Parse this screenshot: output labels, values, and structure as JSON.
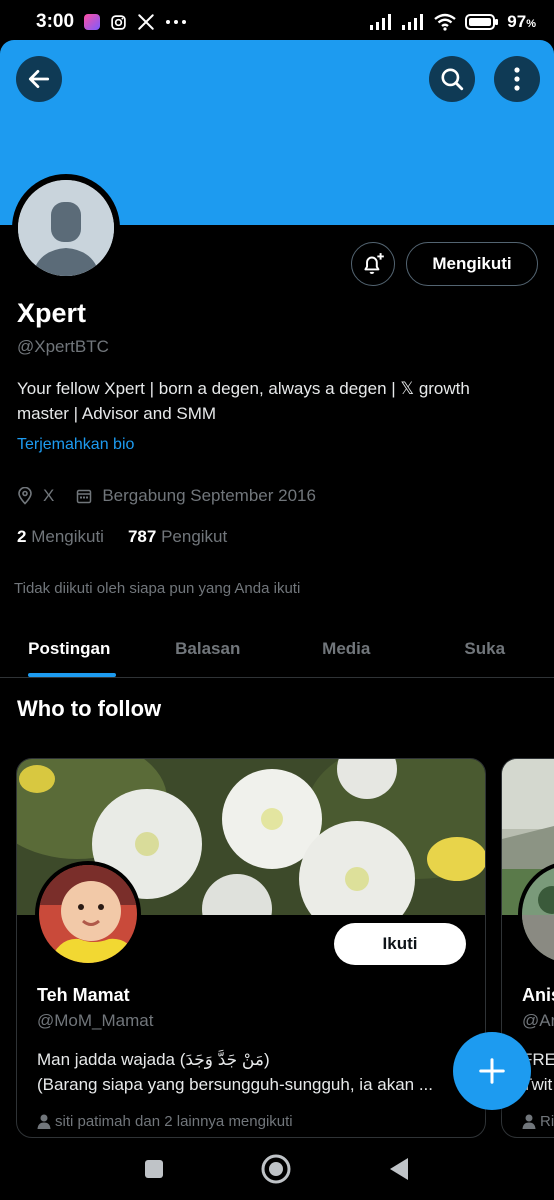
{
  "status_bar": {
    "time": "3:00",
    "battery": "97",
    "battery_unit": "%"
  },
  "header": {
    "back_icon": "arrow-left-icon",
    "search_icon": "search-icon",
    "more_icon": "more-vertical-icon",
    "banner_color": "#1d9bf0"
  },
  "profile": {
    "name": "Xpert",
    "handle": "@XpertBTC",
    "bio_line1": "Your fellow Xpert | born a degen, always a degen | 𝕏 growth",
    "bio_line2": "master | Advisor and SMM",
    "translate_label": "Terjemahkan bio",
    "location": "X",
    "joined": "Bergabung September 2016",
    "following_count": "2",
    "following_label": "Mengikuti",
    "followers_count": "787",
    "followers_label": "Pengikut",
    "not_followed_text": "Tidak diikuti oleh siapa pun yang Anda ikuti",
    "following_button": "Mengikuti"
  },
  "tabs": [
    {
      "label": "Postingan",
      "active": true
    },
    {
      "label": "Balasan",
      "active": false
    },
    {
      "label": "Media",
      "active": false
    },
    {
      "label": "Suka",
      "active": false
    }
  ],
  "who_to_follow": {
    "title": "Who to follow",
    "cards": [
      {
        "name": "Teh Mamat",
        "handle": "@MoM_Mamat",
        "bio_line1": "Man jadda wajada (مَنْ جَدَّ وَجَدَ)",
        "bio_line2": "(Barang siapa yang bersungguh-sungguh, ia akan ...",
        "follows": "siti patimah dan 2 lainnya mengikuti",
        "button": "Ikuti"
      },
      {
        "name": "Anis",
        "handle": "@Ar",
        "bio_line1": "FRE",
        "bio_line2": "Twit",
        "follows": "Ri"
      }
    ]
  },
  "accent_color": "#1d9bf0"
}
